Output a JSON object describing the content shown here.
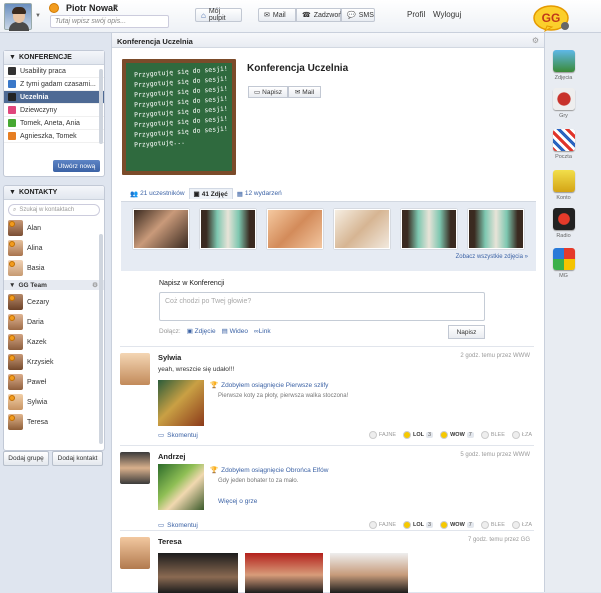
{
  "header": {
    "user_name": "Piotr Nowak",
    "description_placeholder": "Tutaj wpisz swój opis...",
    "home_label": "Mój pulpit",
    "mail_label": "Mail",
    "calls_label": "Zadzwoń",
    "sms_label": "SMS",
    "profile_label": "Profil",
    "logout_label": "Wyloguj",
    "logo_text": "GG"
  },
  "conferences": {
    "title": "KONFERENCJE",
    "items": [
      {
        "label": "Usability praca"
      },
      {
        "label": "Z tymi gadam czasami..."
      },
      {
        "label": "Uczelnia"
      },
      {
        "label": "Dziewczyny"
      },
      {
        "label": "Tomek, Aneta, Ania"
      },
      {
        "label": "Agnieszka, Tomek"
      }
    ],
    "new_button": "Utwórz nową"
  },
  "contacts": {
    "title": "KONTAKTY",
    "search_placeholder": "Szukaj w kontaktach",
    "items": [
      {
        "label": "Alan"
      },
      {
        "label": "Alina"
      },
      {
        "label": "Basia"
      }
    ],
    "group_name": "GG Team",
    "group_items": [
      {
        "label": "Cezary"
      },
      {
        "label": "Daria"
      },
      {
        "label": "Kazek"
      },
      {
        "label": "Krzysiek"
      },
      {
        "label": "Paweł"
      },
      {
        "label": "Sylwia"
      },
      {
        "label": "Teresa"
      }
    ],
    "add_group_button": "Dodaj grupę",
    "add_contact_button": "Dodaj kontakt"
  },
  "main": {
    "title": "Konferencja Uczelnia",
    "conference_name": "Konferencja Uczelnia",
    "board_line": "Przygotuję się do sesji!",
    "board_last": "Przygotuję...",
    "write_button": "Napisz",
    "mail_button": "Mail",
    "tabs": [
      {
        "label": "21 uczestników"
      },
      {
        "label": "41 Zdjęć"
      },
      {
        "label": "12 wydarzeń"
      }
    ],
    "see_all_photos": "Zobacz wszystkie zdjęcia »",
    "compose_title": "Napisz w Konferencji",
    "compose_placeholder": "Coż chodzi po Twej głowie?",
    "attach_label": "Dołącz:",
    "attach_photo": "Zdjęcie",
    "attach_video": "Wideo",
    "attach_link": "Link",
    "send_button": "Napisz"
  },
  "posts": [
    {
      "author": "Sylwia",
      "time": "2 godz. temu przez WWW",
      "text": "yeah, wreszcie się udało!!!",
      "achievement": "Zdobyłem osiągnięcie Pierwsze szlify",
      "achievement_desc": "Pierwsze koty za płoty, pierwsza walka stoczona!",
      "comment_label": "Skomentuj",
      "reactions": [
        {
          "label": "FAJNE",
          "count": ""
        },
        {
          "label": "LOL",
          "count": "3"
        },
        {
          "label": "WOW",
          "count": "7"
        },
        {
          "label": "BLEE",
          "count": ""
        },
        {
          "label": "ŁZA",
          "count": ""
        }
      ]
    },
    {
      "author": "Andrzej",
      "time": "5 godz. temu przez WWW",
      "achievement": "Zdobyłem osiągnięcie Obrońca Elfów",
      "achievement_desc": "Gdy jeden bohater to za mało.",
      "more_link": "Więcej o grze",
      "comment_label": "Skomentuj",
      "reactions": [
        {
          "label": "FAJNE",
          "count": ""
        },
        {
          "label": "LOL",
          "count": "3"
        },
        {
          "label": "WOW",
          "count": "7"
        },
        {
          "label": "BLEE",
          "count": ""
        },
        {
          "label": "ŁZA",
          "count": ""
        }
      ]
    },
    {
      "author": "Teresa",
      "time": "7 godz. temu przez GG"
    }
  ],
  "apps": [
    {
      "label": "Zdjęcia"
    },
    {
      "label": "Gry"
    },
    {
      "label": "Poczta"
    },
    {
      "label": "Konto"
    },
    {
      "label": "Radio"
    },
    {
      "label": "MG"
    }
  ]
}
